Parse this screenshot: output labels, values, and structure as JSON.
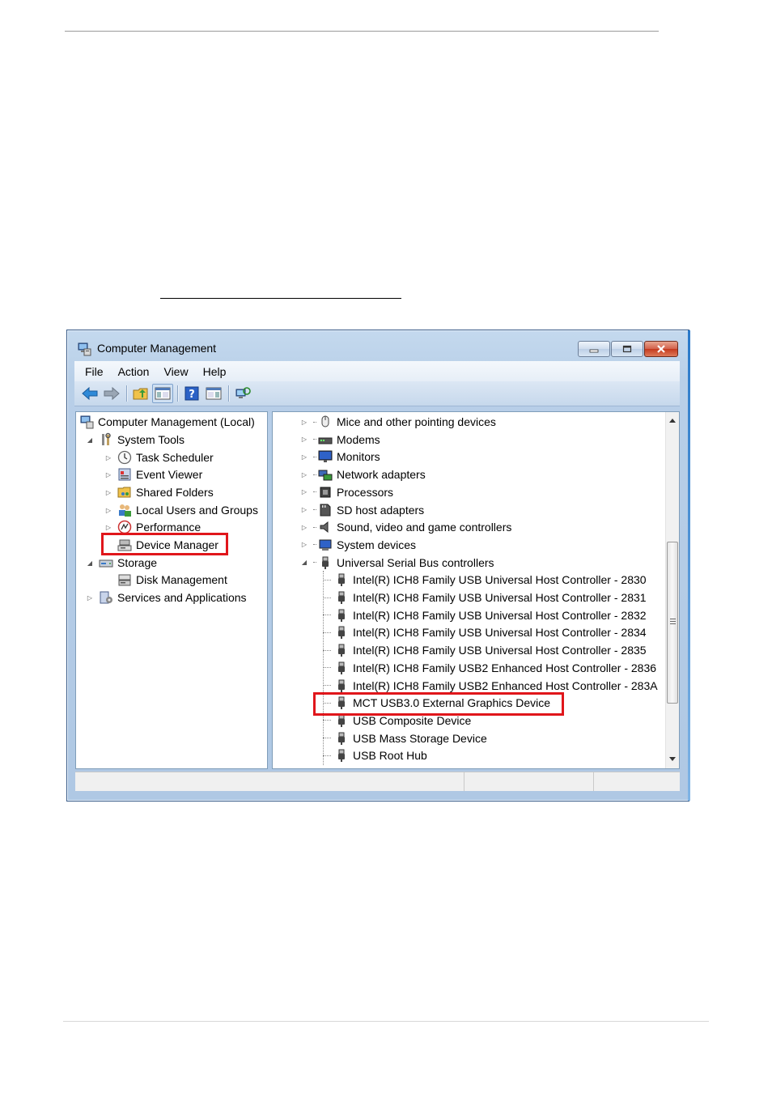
{
  "window": {
    "title": "Computer Management",
    "menu": [
      "File",
      "Action",
      "View",
      "Help"
    ]
  },
  "toolbar": {
    "buttons": [
      "back-arrow-icon",
      "forward-arrow-icon",
      "up-folder-icon",
      "show-hide-console-tree-icon",
      "help-icon",
      "properties-pane-icon",
      "refresh-icon"
    ]
  },
  "left_tree": {
    "items": [
      {
        "label": "Computer Management (Local)",
        "icon": "computer-management-icon",
        "expander": ""
      },
      {
        "label": "System Tools",
        "icon": "system-tools-icon",
        "expander": "expanded"
      },
      {
        "label": "Task Scheduler",
        "icon": "clock-icon",
        "expander": "collapsed"
      },
      {
        "label": "Event Viewer",
        "icon": "event-viewer-icon",
        "expander": "collapsed"
      },
      {
        "label": "Shared Folders",
        "icon": "shared-folder-icon",
        "expander": "collapsed"
      },
      {
        "label": "Local Users and Groups",
        "icon": "users-icon",
        "expander": "collapsed"
      },
      {
        "label": "Performance",
        "icon": "performance-icon",
        "expander": "collapsed"
      },
      {
        "label": "Device Manager",
        "icon": "device-manager-icon",
        "expander": ""
      },
      {
        "label": "Storage",
        "icon": "storage-icon",
        "expander": "expanded"
      },
      {
        "label": "Disk Management",
        "icon": "disk-icon",
        "expander": ""
      },
      {
        "label": "Services and Applications",
        "icon": "services-icon",
        "expander": "collapsed"
      }
    ]
  },
  "right_tree": {
    "items": [
      {
        "label": "Mice and other pointing devices",
        "icon": "mouse-icon",
        "expander": "collapsed"
      },
      {
        "label": "Modems",
        "icon": "modem-icon",
        "expander": "collapsed"
      },
      {
        "label": "Monitors",
        "icon": "monitor-icon",
        "expander": "collapsed"
      },
      {
        "label": "Network adapters",
        "icon": "network-icon",
        "expander": "collapsed"
      },
      {
        "label": "Processors",
        "icon": "processor-icon",
        "expander": "collapsed"
      },
      {
        "label": "SD host adapters",
        "icon": "sd-card-icon",
        "expander": "collapsed"
      },
      {
        "label": "Sound, video and game controllers",
        "icon": "speaker-icon",
        "expander": "collapsed"
      },
      {
        "label": "System devices",
        "icon": "system-device-icon",
        "expander": "collapsed"
      },
      {
        "label": "Universal Serial Bus controllers",
        "icon": "usb-icon",
        "expander": "expanded"
      },
      {
        "label": "Intel(R) ICH8 Family USB Universal Host Controller - 2830",
        "icon": "usb-icon",
        "expander": ""
      },
      {
        "label": "Intel(R) ICH8 Family USB Universal Host Controller - 2831",
        "icon": "usb-icon",
        "expander": ""
      },
      {
        "label": "Intel(R) ICH8 Family USB Universal Host Controller - 2832",
        "icon": "usb-icon",
        "expander": ""
      },
      {
        "label": "Intel(R) ICH8 Family USB Universal Host Controller - 2834",
        "icon": "usb-icon",
        "expander": ""
      },
      {
        "label": "Intel(R) ICH8 Family USB Universal Host Controller - 2835",
        "icon": "usb-icon",
        "expander": ""
      },
      {
        "label": "Intel(R) ICH8 Family USB2 Enhanced Host Controller - 2836",
        "icon": "usb-icon",
        "expander": ""
      },
      {
        "label": "Intel(R) ICH8 Family USB2 Enhanced Host Controller - 283A",
        "icon": "usb-icon",
        "expander": ""
      },
      {
        "label": "MCT USB3.0 External Graphics Device",
        "icon": "usb-icon",
        "expander": ""
      },
      {
        "label": "USB Composite Device",
        "icon": "usb-icon",
        "expander": ""
      },
      {
        "label": "USB Mass Storage Device",
        "icon": "usb-icon",
        "expander": ""
      },
      {
        "label": "USB Root Hub",
        "icon": "usb-icon",
        "expander": ""
      }
    ]
  },
  "colors": {
    "highlight": "#e0161b",
    "window_frame": "#b8cfe8"
  }
}
